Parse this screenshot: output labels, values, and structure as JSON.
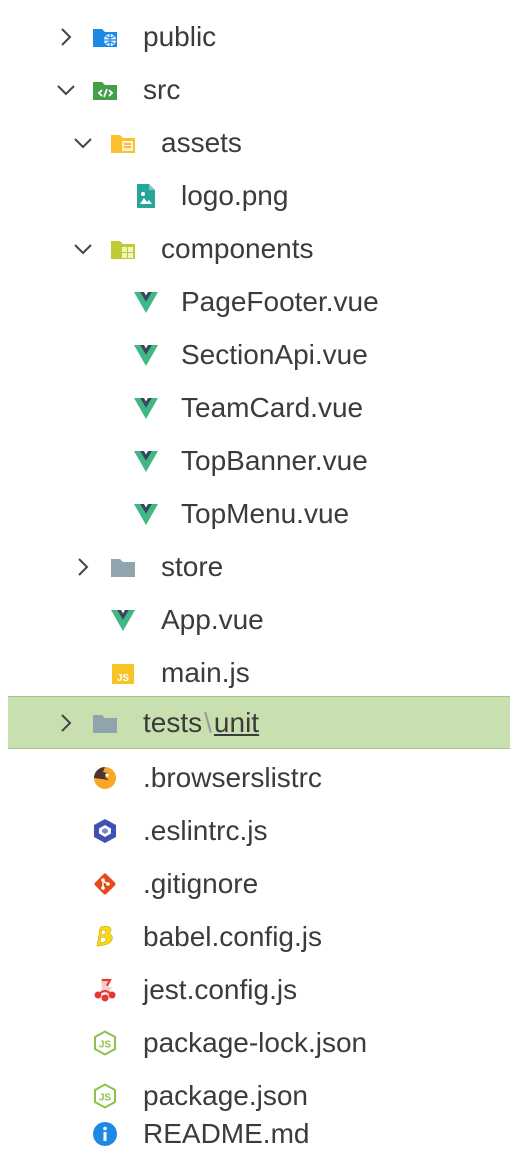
{
  "explorer": {
    "items": [
      {
        "label": "public",
        "icon": "folder-public-icon",
        "expanded": false
      },
      {
        "label": "src",
        "icon": "folder-src-icon",
        "expanded": true
      },
      {
        "label": "assets",
        "icon": "folder-assets-icon",
        "expanded": true
      },
      {
        "label": "logo.png",
        "icon": "image-file-icon"
      },
      {
        "label": "components",
        "icon": "folder-components-icon",
        "expanded": true
      },
      {
        "label": "PageFooter.vue",
        "icon": "vue-icon"
      },
      {
        "label": "SectionApi.vue",
        "icon": "vue-icon"
      },
      {
        "label": "TeamCard.vue",
        "icon": "vue-icon"
      },
      {
        "label": "TopBanner.vue",
        "icon": "vue-icon"
      },
      {
        "label": "TopMenu.vue",
        "icon": "vue-icon"
      },
      {
        "label": "store",
        "icon": "folder-icon",
        "expanded": false
      },
      {
        "label": "App.vue",
        "icon": "vue-icon"
      },
      {
        "label": "main.js",
        "icon": "js-icon"
      },
      {
        "label": "tests",
        "label2": "unit",
        "separator": "\\",
        "icon": "folder-icon",
        "expanded": false,
        "selected": true
      },
      {
        "label": ".browserslistrc",
        "icon": "browserslist-icon"
      },
      {
        "label": ".eslintrc.js",
        "icon": "eslint-icon"
      },
      {
        "label": ".gitignore",
        "icon": "git-icon"
      },
      {
        "label": "babel.config.js",
        "icon": "babel-icon"
      },
      {
        "label": "jest.config.js",
        "icon": "jest-icon"
      },
      {
        "label": "package-lock.json",
        "icon": "nodejs-icon"
      },
      {
        "label": "package.json",
        "icon": "nodejs-icon"
      },
      {
        "label": "README.md",
        "icon": "info-icon"
      }
    ]
  },
  "colors": {
    "selection_bg": "#c8dfb0",
    "vue_green": "#41b883",
    "vue_dark": "#35495e",
    "folder_grey": "#90a4ae",
    "folder_blue": "#1e88e5",
    "folder_green": "#43a047",
    "folder_yellow": "#fbc02d",
    "js_yellow": "#f7c325"
  }
}
